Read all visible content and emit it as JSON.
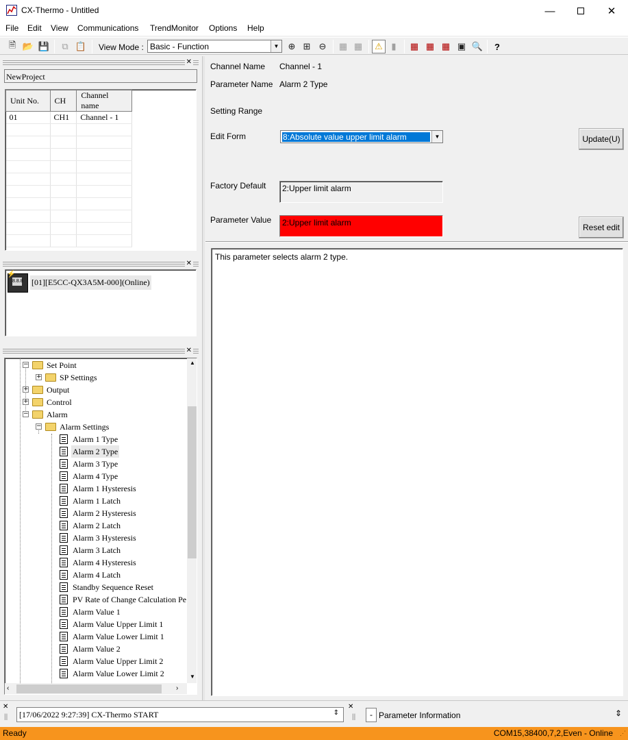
{
  "window": {
    "title": "CX-Thermo - Untitled"
  },
  "menu": [
    "File",
    "Edit",
    "View",
    "Communications",
    "TrendMonitor",
    "Options",
    "Help"
  ],
  "toolbar": {
    "view_mode_label": "View Mode :",
    "view_mode_value": "Basic - Function"
  },
  "project": {
    "name": "NewProject"
  },
  "unit_table": {
    "headers": [
      "Unit No.",
      "CH",
      "Channel name"
    ],
    "rows": [
      [
        "01",
        "CH1",
        "Channel - 1"
      ]
    ]
  },
  "device": {
    "label": "[01][E5CC-QX3A5M-000](Online)",
    "icon_text": "8.8.8"
  },
  "tree": {
    "items": [
      "Set Point",
      "SP Settings",
      "Output",
      "Control",
      "Alarm",
      "Alarm Settings",
      "Alarm 1 Type",
      "Alarm 2 Type",
      "Alarm 3 Type",
      "Alarm 4 Type",
      "Alarm 1 Hysteresis",
      "Alarm 1 Latch",
      "Alarm 2 Hysteresis",
      "Alarm 2 Latch",
      "Alarm 3 Hysteresis",
      "Alarm 3 Latch",
      "Alarm 4 Hysteresis",
      "Alarm 4 Latch",
      "Standby Sequence Reset",
      "PV Rate of Change Calculation Pe",
      "Alarm Value 1",
      "Alarm Value Upper Limit 1",
      "Alarm Value Lower Limit 1",
      "Alarm Value 2",
      "Alarm Value Upper Limit 2",
      "Alarm Value Lower Limit 2"
    ]
  },
  "detail": {
    "channel_name_label": "Channel Name",
    "channel_name_value": "Channel - 1",
    "parameter_name_label": "Parameter Name",
    "parameter_name_value": "Alarm 2 Type",
    "setting_range_label": "Setting Range",
    "edit_form_label": "Edit Form",
    "edit_form_value": "8:Absolute value upper limit alarm",
    "update_button": "Update(U)",
    "factory_default_label": "Factory Default",
    "factory_default_value": "2:Upper limit alarm",
    "parameter_value_label": "Parameter Value",
    "parameter_value_value": "2:Upper limit alarm",
    "reset_edit_button": "Reset edit",
    "description": "This parameter selects alarm 2 type."
  },
  "log": {
    "entry": "[17/06/2022 9:27:39] CX-Thermo START"
  },
  "param_info": {
    "toggle": "-",
    "label": "Parameter Information"
  },
  "status": {
    "left": "Ready",
    "right": "COM15,38400,7,2,Even - Online"
  },
  "colors": {
    "status_bar": "#f7941d",
    "parameter_value_bg": "#ff0000",
    "selection": "#0078d7"
  }
}
